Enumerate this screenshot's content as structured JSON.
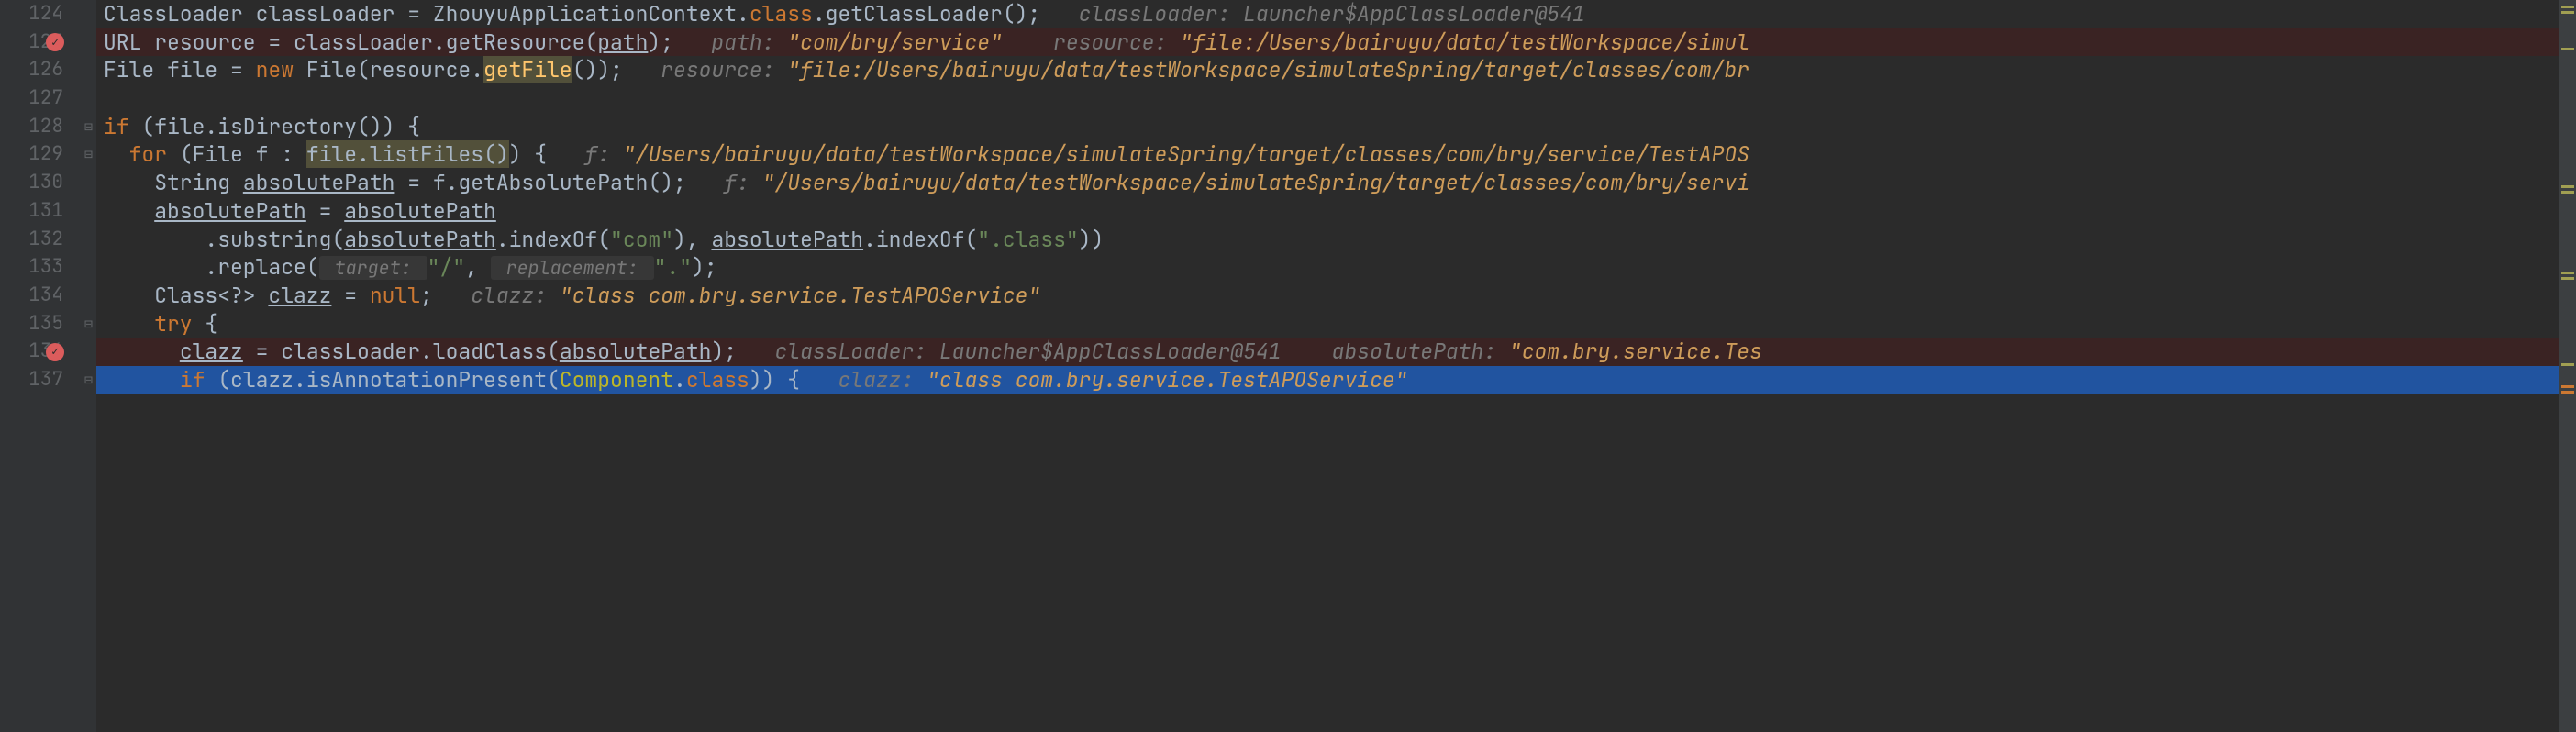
{
  "lines": {
    "124": {
      "num": "124",
      "code_prefix": "ClassLoader classLoader = ZhouyuApplicationContext.",
      "kw_class": "class",
      "code_mid": ".getClassLoader();",
      "hint_lbl": "   classLoader: ",
      "hint_val": "Launcher$AppClassLoader@541"
    },
    "125": {
      "num": "125",
      "code_prefix": "URL resource = classLoader.getResource(",
      "param": "path",
      "code_suffix": ");",
      "hint_lbl1": "   path: ",
      "hint_val1": "\"com/bry/service\"",
      "hint_lbl2": "    resource: ",
      "hint_val2": "\"file:/Users/bairuyu/data/testWorkspace/simul"
    },
    "126": {
      "num": "126",
      "code_prefix": "File file = ",
      "kw_new": "new",
      "code_mid": " File(resource.",
      "meth": "getFile",
      "code_suffix": "());",
      "hint_lbl": "   resource: ",
      "hint_val": "\"file:/Users/bairuyu/data/testWorkspace/simulateSpring/target/classes/com/br"
    },
    "127": {
      "num": "127"
    },
    "128": {
      "num": "128",
      "kw": "if",
      "code": " (file.isDirectory()) {"
    },
    "129": {
      "num": "129",
      "kw": "for",
      "code_prefix": " (File f : ",
      "hl": "file.listFiles()",
      "code_suffix": ") {",
      "hint_lbl": "   f: ",
      "hint_val": "\"/Users/bairuyu/data/testWorkspace/simulateSpring/target/classes/com/bry/service/TestAPOS"
    },
    "130": {
      "num": "130",
      "code_prefix": "String ",
      "underline1": "absolutePath",
      "code_mid": " = f.getAbsolutePath();",
      "hint_lbl": "   f: ",
      "hint_val": "\"/Users/bairuyu/data/testWorkspace/simulateSpring/target/classes/com/bry/servi"
    },
    "131": {
      "num": "131",
      "underline1": "absolutePath",
      "code_mid": " = ",
      "underline2": "absolutePath"
    },
    "132": {
      "num": "132",
      "code_prefix": ".substring(",
      "underline1": "absolutePath",
      "code_mid1": ".indexOf(",
      "str1": "\"com\"",
      "code_mid2": "), ",
      "underline2": "absolutePath",
      "code_mid3": ".indexOf(",
      "str2": "\".class\"",
      "code_suffix": "))"
    },
    "133": {
      "num": "133",
      "code_prefix": ".replace(",
      "param_hint1": " target: ",
      "str1": "\"/\"",
      "code_mid": ", ",
      "param_hint2": " replacement: ",
      "str2": "\".\"",
      "code_suffix": ");"
    },
    "134": {
      "num": "134",
      "code_prefix": "Class<?> ",
      "underline1": "clazz",
      "code_mid": " = ",
      "kw": "null",
      "code_suffix": ";",
      "hint_lbl": "   clazz: ",
      "hint_val": "\"class com.bry.service.TestAPOService\""
    },
    "135": {
      "num": "135",
      "kw": "try",
      "code": " {"
    },
    "136": {
      "num": "136",
      "underline1": "clazz",
      "code_mid": " = classLoader.loadClass(",
      "underline2": "absolutePath",
      "code_suffix": ");",
      "hint_lbl1": "   classLoader: ",
      "hint_val1": "Launcher$AppClassLoader@541",
      "hint_lbl2": "    absolutePath: ",
      "hint_val2": "\"com.bry.service.Tes"
    },
    "137": {
      "num": "137",
      "kw": "if",
      "code_prefix": " (clazz.isAnnotationPresent(",
      "annotation": "Component",
      "code_mid": ".",
      "kw_class": "class",
      "code_suffix": ")) {",
      "hint_lbl": "   clazz: ",
      "hint_val": "\"class com.bry.service.TestAPOService\""
    }
  }
}
